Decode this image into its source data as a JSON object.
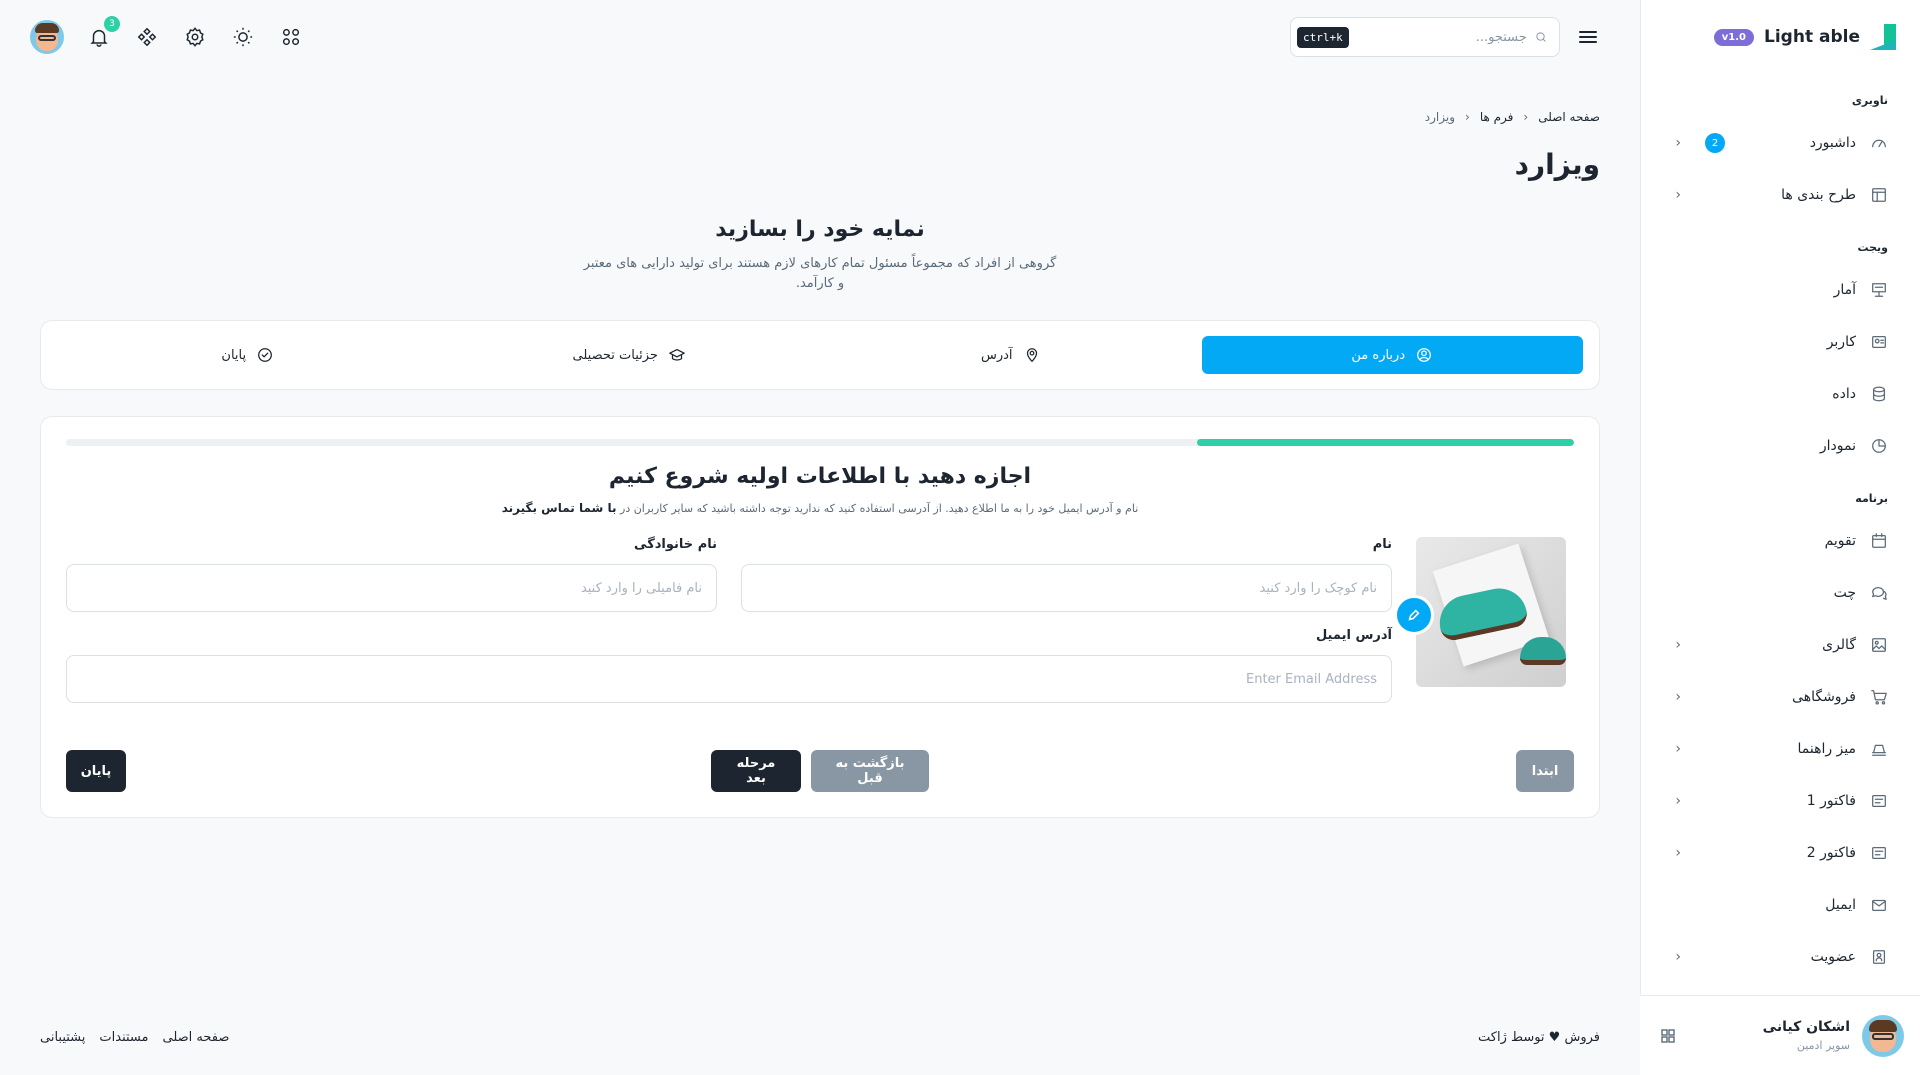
{
  "brand": {
    "name": "Light able",
    "version": "v1.0"
  },
  "sidebar": {
    "sections": [
      {
        "caption": "ناوبری",
        "items": [
          {
            "label": "داشبورد",
            "icon": "dashboard-icon",
            "badge": "2",
            "chevron": true
          },
          {
            "label": "طرح بندی ها",
            "icon": "layout-icon",
            "chevron": true
          }
        ]
      },
      {
        "caption": "ویجت",
        "items": [
          {
            "label": "آمار",
            "icon": "presentation-icon"
          },
          {
            "label": "کاربر",
            "icon": "user-card-icon"
          },
          {
            "label": "داده",
            "icon": "database-icon"
          },
          {
            "label": "نمودار",
            "icon": "pie-chart-icon"
          }
        ]
      },
      {
        "caption": "برنامه",
        "items": [
          {
            "label": "تقویم",
            "icon": "calendar-icon"
          },
          {
            "label": "چت",
            "icon": "chat-icon"
          },
          {
            "label": "گالری",
            "icon": "gallery-icon",
            "chevron": true
          },
          {
            "label": "فروشگاهی",
            "icon": "cart-icon",
            "chevron": true
          },
          {
            "label": "میز راهنما",
            "icon": "helpdesk-icon",
            "chevron": true
          },
          {
            "label": "فاکتور 1",
            "icon": "invoice-icon",
            "chevron": true
          },
          {
            "label": "فاکتور 2",
            "icon": "invoice-icon",
            "chevron": true
          },
          {
            "label": "ایمیل",
            "icon": "mail-icon"
          },
          {
            "label": "عضویت",
            "icon": "membership-icon",
            "chevron": true
          }
        ]
      }
    ],
    "user": {
      "name": "اشکان کیانی",
      "role": "سوپر ادمین"
    }
  },
  "header": {
    "search_placeholder": "جستجو...",
    "shortcut": "ctrl+k",
    "notification_count": "3"
  },
  "breadcrumb": {
    "home": "صفحه اصلی",
    "forms": "فرم ها",
    "current": "ویزارد"
  },
  "page_title": "ویزارد",
  "intro": {
    "title": "نمایه خود را بسازید",
    "description": "گروهی از افراد که مجموعاً مسئول تمام کارهای لازم هستند برای تولید دارایی های معتبر و کارآمد."
  },
  "steps": [
    {
      "label": "درباره من",
      "icon": "user-circle-icon",
      "active": true
    },
    {
      "label": "آدرس",
      "icon": "location-pin-icon"
    },
    {
      "label": "جزئیات تحصیلی",
      "icon": "graduation-cap-icon"
    },
    {
      "label": "پایان",
      "icon": "check-circle-icon"
    }
  ],
  "form": {
    "progress": 0.25,
    "heading": "اجازه دهید با اطلاعات اولیه شروع کنیم",
    "subtext": "نام و آدرس ایمیل خود را به ما اطلاع دهید. از آدرسی استفاده کنید که ندارید توجه داشته باشید که سایر کاربران در",
    "subtext_bold": "با شما تماس بگیرند",
    "first_name_label": "نام",
    "first_name_placeholder": "نام کوچک را وارد کنید",
    "last_name_label": "نام خانوادگی",
    "last_name_placeholder": "نام فامیلی را وارد کنید",
    "email_label": "آدرس ایمیل",
    "email_placeholder": "Enter Email Address",
    "buttons": {
      "first": "ابتدا",
      "prev": "بازگشت به قبل",
      "next": "مرحله بعد",
      "finish": "پایان"
    }
  },
  "footer": {
    "credits": "فروش ♥ توسط ژاکت",
    "links": [
      "صفحه اصلی",
      "مستندات",
      "پشتیبانی"
    ]
  }
}
